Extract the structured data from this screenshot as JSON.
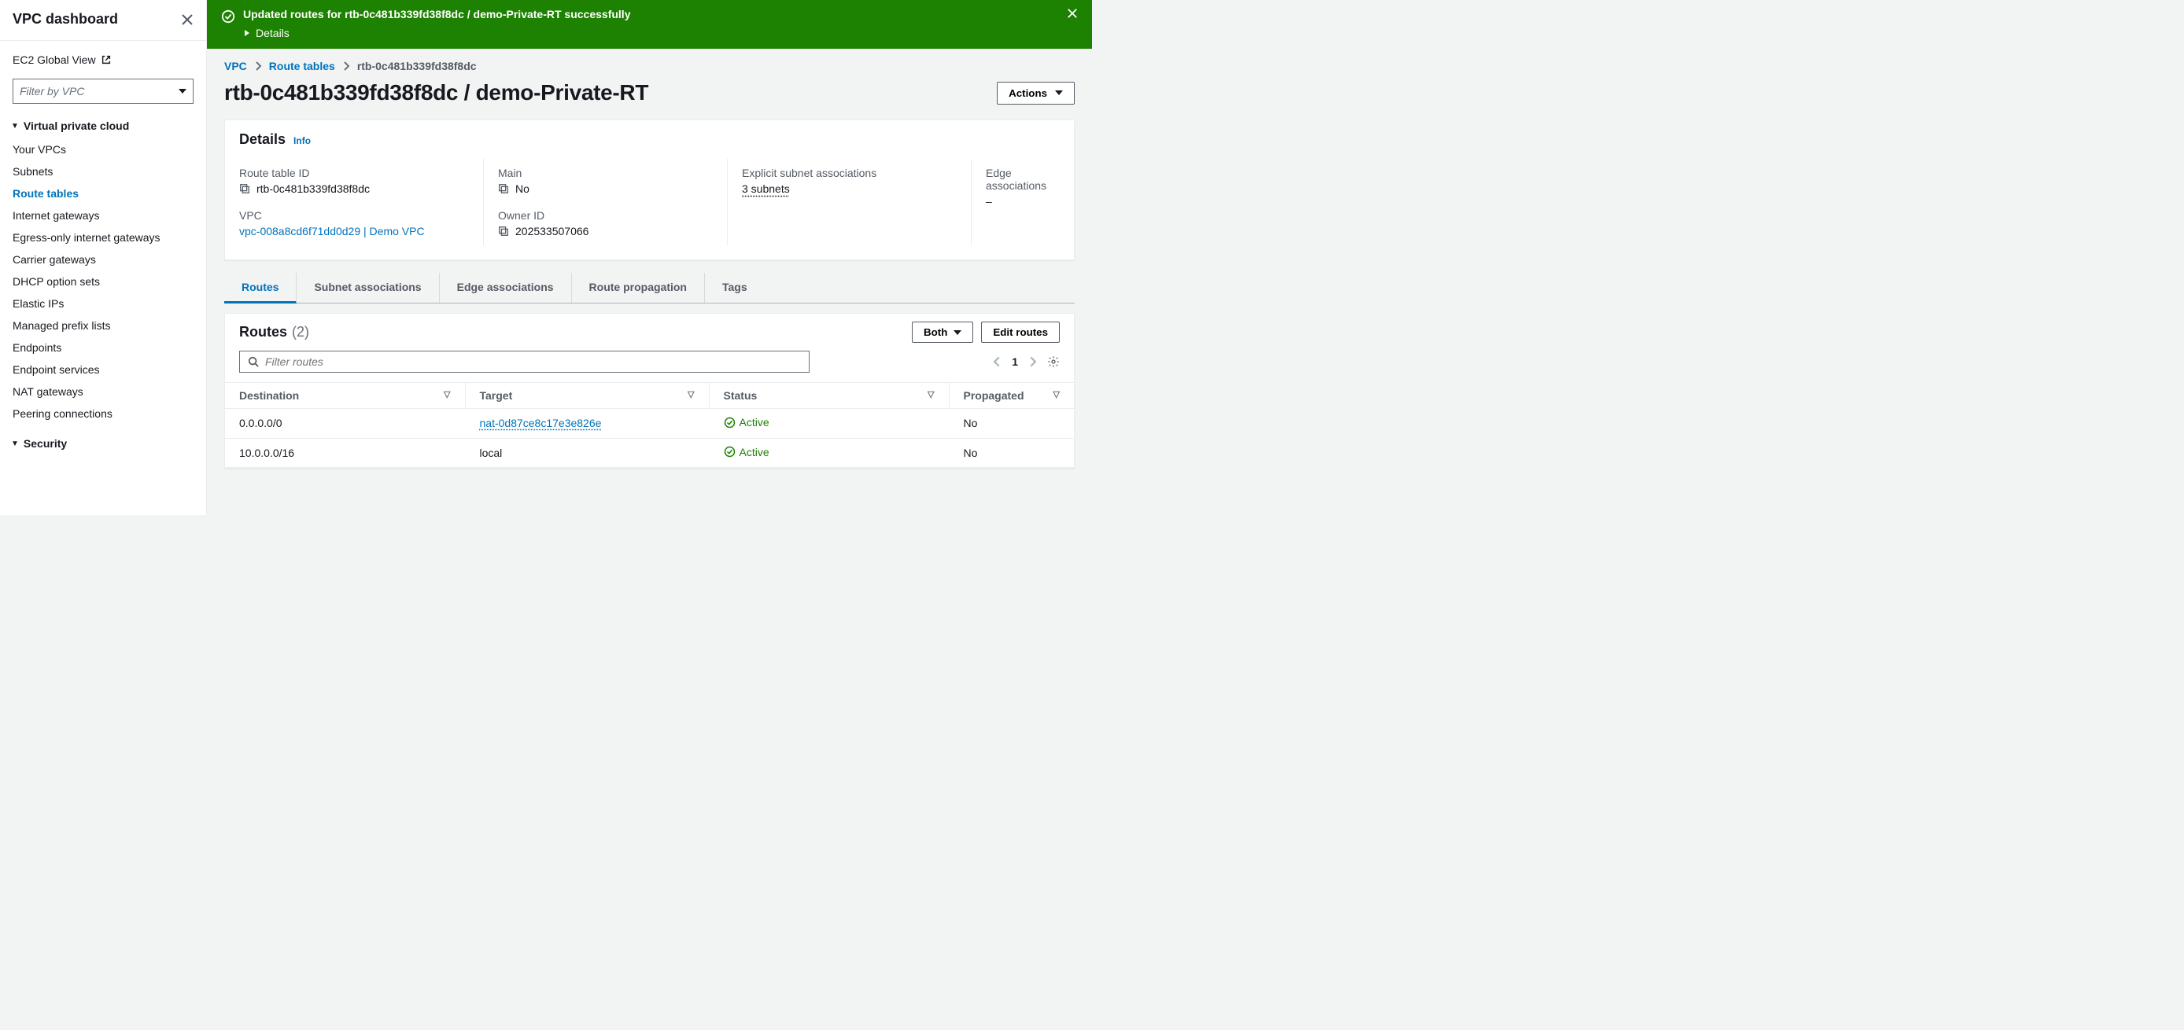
{
  "sidebar": {
    "title": "VPC dashboard",
    "ec2_link": "EC2 Global View",
    "filter_placeholder": "Filter by VPC",
    "sections": [
      {
        "label": "Virtual private cloud",
        "items": [
          {
            "label": "Your VPCs",
            "active": false
          },
          {
            "label": "Subnets",
            "active": false
          },
          {
            "label": "Route tables",
            "active": true
          },
          {
            "label": "Internet gateways",
            "active": false
          },
          {
            "label": "Egress-only internet gateways",
            "active": false
          },
          {
            "label": "Carrier gateways",
            "active": false
          },
          {
            "label": "DHCP option sets",
            "active": false
          },
          {
            "label": "Elastic IPs",
            "active": false
          },
          {
            "label": "Managed prefix lists",
            "active": false
          },
          {
            "label": "Endpoints",
            "active": false
          },
          {
            "label": "Endpoint services",
            "active": false
          },
          {
            "label": "NAT gateways",
            "active": false
          },
          {
            "label": "Peering connections",
            "active": false
          }
        ]
      },
      {
        "label": "Security",
        "items": []
      }
    ]
  },
  "banner": {
    "title": "Updated routes for rtb-0c481b339fd38f8dc / demo-Private-RT successfully",
    "details_label": "Details"
  },
  "breadcrumb": {
    "vpc": "VPC",
    "rt": "Route tables",
    "current": "rtb-0c481b339fd38f8dc"
  },
  "page_title": "rtb-0c481b339fd38f8dc / demo-Private-RT",
  "actions_label": "Actions",
  "details_panel": {
    "heading": "Details",
    "info": "Info",
    "route_table_id_label": "Route table ID",
    "route_table_id": "rtb-0c481b339fd38f8dc",
    "vpc_label": "VPC",
    "vpc_value": "vpc-008a8cd6f71dd0d29 | Demo VPC",
    "main_label": "Main",
    "main_value": "No",
    "owner_label": "Owner ID",
    "owner_value": "202533507066",
    "subnet_assoc_label": "Explicit subnet associations",
    "subnet_assoc_value": "3 subnets",
    "edge_assoc_label": "Edge associations",
    "edge_assoc_value": "–"
  },
  "tabs": [
    {
      "label": "Routes",
      "active": true
    },
    {
      "label": "Subnet associations",
      "active": false
    },
    {
      "label": "Edge associations",
      "active": false
    },
    {
      "label": "Route propagation",
      "active": false
    },
    {
      "label": "Tags",
      "active": false
    }
  ],
  "routes_panel": {
    "heading": "Routes",
    "count": "(2)",
    "both_label": "Both",
    "edit_label": "Edit routes",
    "search_placeholder": "Filter routes",
    "page_number": "1",
    "columns": {
      "destination": "Destination",
      "target": "Target",
      "status": "Status",
      "propagated": "Propagated"
    },
    "rows": [
      {
        "destination": "0.0.0.0/0",
        "target": "nat-0d87ce8c17e3e826e",
        "target_link": true,
        "status": "Active",
        "propagated": "No"
      },
      {
        "destination": "10.0.0.0/16",
        "target": "local",
        "target_link": false,
        "status": "Active",
        "propagated": "No"
      }
    ]
  }
}
